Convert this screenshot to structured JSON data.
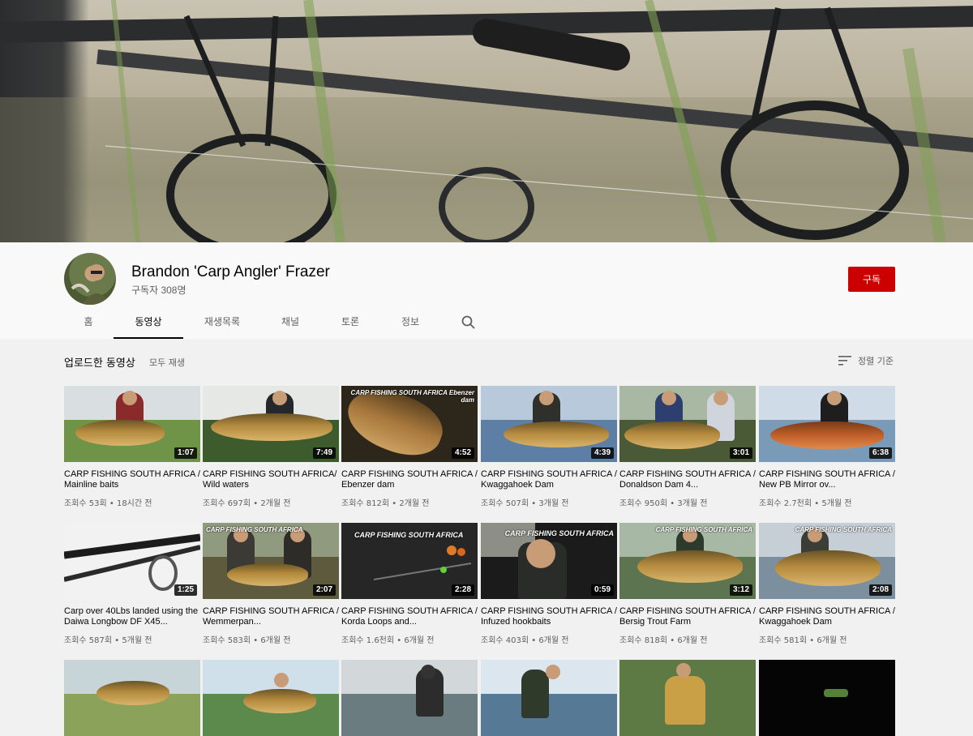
{
  "channel": {
    "name": "Brandon 'Carp Angler' Frazer",
    "subscribers": "구독자 308명",
    "subscribe_label": "구독"
  },
  "tabs": [
    {
      "label": "홈"
    },
    {
      "label": "동영상"
    },
    {
      "label": "재생목록"
    },
    {
      "label": "채널"
    },
    {
      "label": "토론"
    },
    {
      "label": "정보"
    }
  ],
  "section": {
    "title": "업로드한 동영상",
    "play_all": "모두 재생",
    "sort_label": "정렬 기준"
  },
  "videos_row1": [
    {
      "title": "CARP FISHING SOUTH AFRICA / Mainline baits",
      "meta": "조회수 53회 • 18시간 전",
      "duration": "1:07",
      "thumb_caption": ""
    },
    {
      "title": "CARP FISHING SOUTH AFRICA/ Wild waters",
      "meta": "조회수 697회 • 2개월 전",
      "duration": "7:49",
      "thumb_caption": ""
    },
    {
      "title": "CARP FISHING SOUTH AFRICA / Ebenzer dam",
      "meta": "조회수 812회 • 2개월 전",
      "duration": "4:52",
      "thumb_caption": "CARP FISHING SOUTH AFRICA Ebenzer dam"
    },
    {
      "title": "CARP FISHING SOUTH AFRICA / Kwaggahoek Dam",
      "meta": "조회수 507회 • 3개월 전",
      "duration": "4:39",
      "thumb_caption": ""
    },
    {
      "title": "CARP FISHING SOUTH AFRICA / Donaldson Dam 4...",
      "meta": "조회수 950회 • 3개월 전",
      "duration": "3:01",
      "thumb_caption": ""
    },
    {
      "title": "CARP FISHING SOUTH AFRICA / New PB Mirror ov...",
      "meta": "조회수 2.7천회 • 5개월 전",
      "duration": "6:38",
      "thumb_caption": ""
    }
  ],
  "videos_row2": [
    {
      "title": "Carp over 40Lbs landed using the Daiwa Longbow DF X45...",
      "meta": "조회수 587회 • 5개월 전",
      "duration": "1:25",
      "thumb_caption": ""
    },
    {
      "title": "CARP FISHING SOUTH AFRICA / Wemmerpan...",
      "meta": "조회수 583회 • 6개월 전",
      "duration": "2:07",
      "thumb_caption": "CARP FISHING SOUTH AFRICA"
    },
    {
      "title": "CARP FISHING SOUTH AFRICA / Korda Loops and...",
      "meta": "조회수 1.6천회 • 6개월 전",
      "duration": "2:28",
      "thumb_caption": "CARP FISHING SOUTH AFRICA"
    },
    {
      "title": "CARP FISHING SOUTH AFRICA / Infuzed hookbaits",
      "meta": "조회수 403회 • 6개월 전",
      "duration": "0:59",
      "thumb_caption": "CARP FISHING SOUTH AFRICA"
    },
    {
      "title": "CARP FISHING SOUTH AFRICA / Bersig Trout Farm",
      "meta": "조회수 818회 • 6개월 전",
      "duration": "3:12",
      "thumb_caption": "CARP FISHING SOUTH AFRICA"
    },
    {
      "title": "CARP FISHING SOUTH AFRICA / Kwaggahoek Dam",
      "meta": "조회수 581회 • 6개월 전",
      "duration": "2:08",
      "thumb_caption": "CARP FISHING SOUTH AFRICA"
    }
  ],
  "colors": {
    "subscribe": "#cc0000",
    "accent_text": "#030303",
    "secondary_text": "#606060"
  }
}
